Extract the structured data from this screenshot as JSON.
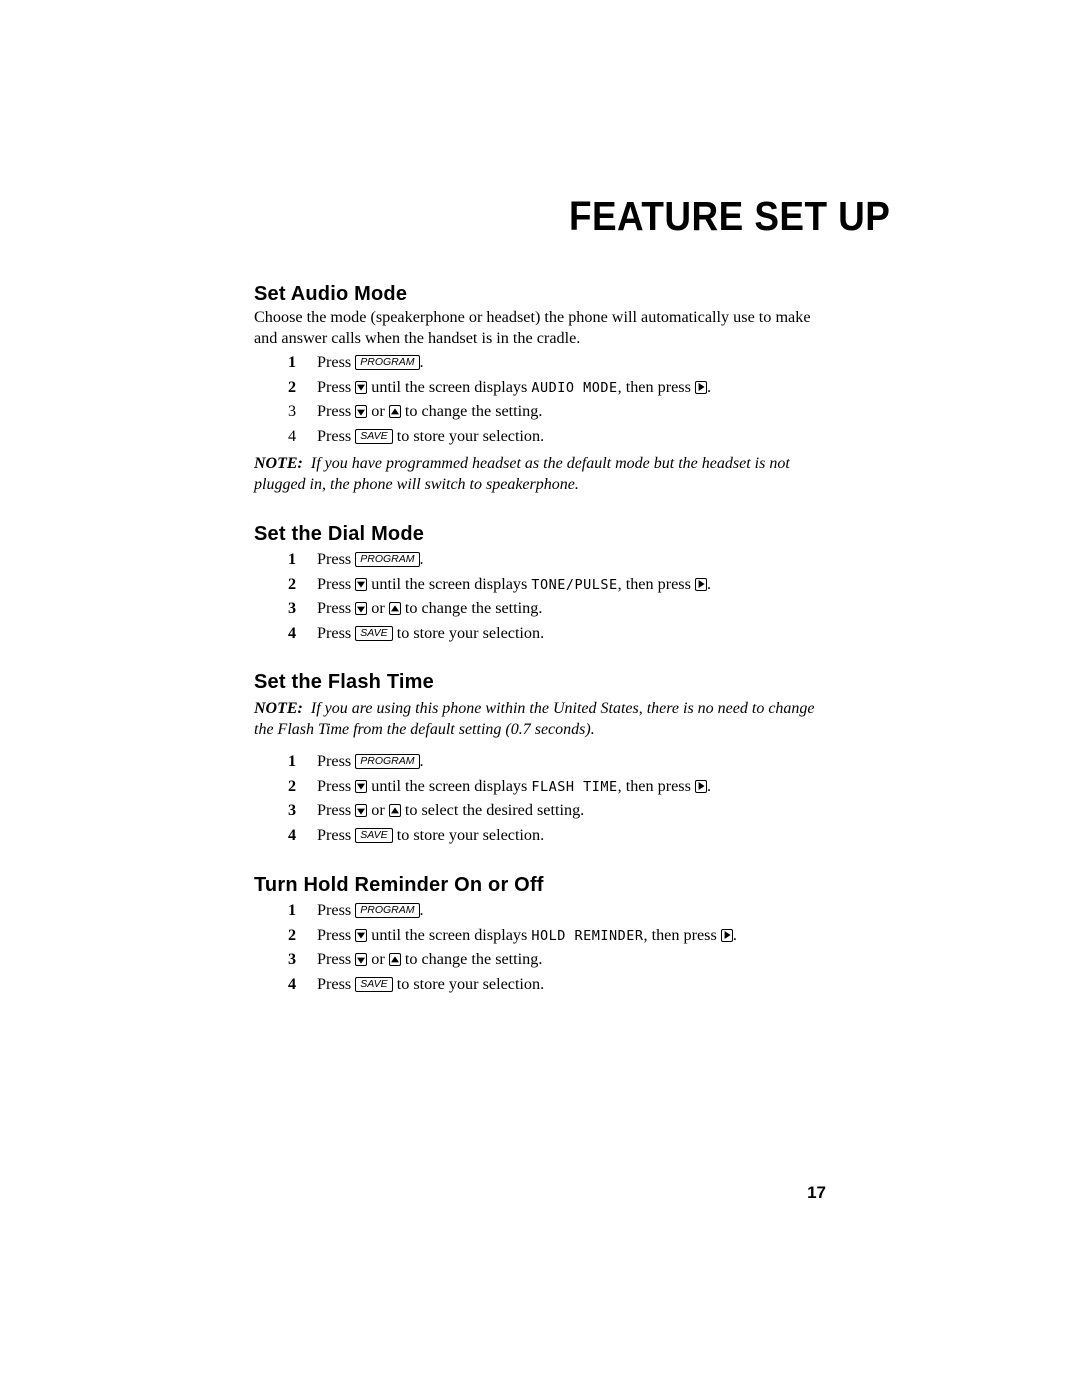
{
  "page": {
    "title": "FEATURE SET UP",
    "page_number": "17"
  },
  "keys": {
    "program": "PROGRAM",
    "save": "SAVE"
  },
  "sections": [
    {
      "heading": "Set Audio Mode",
      "intro": "Choose the mode (speakerphone or headset) the phone will automatically use to make and answer calls when the handset is in the cradle.",
      "steps": [
        {
          "num": "1",
          "press": "Press",
          "after": "."
        },
        {
          "num": "2",
          "press": "Press",
          "mid": "until the screen displays",
          "display": "AUDIO MODE",
          "then": ", then press",
          "after": "."
        },
        {
          "num": "3",
          "press": "Press",
          "or": "or",
          "after": "to change the setting."
        },
        {
          "num": "4",
          "press": "Press",
          "after": "to store your selection."
        }
      ],
      "note_label": "NOTE:",
      "note": "If you have programmed headset as the default mode but the headset is not plugged in, the phone will switch to speakerphone."
    },
    {
      "heading": "Set the Dial Mode",
      "steps": [
        {
          "num": "1",
          "press": "Press",
          "after": "."
        },
        {
          "num": "2",
          "press": "Press",
          "mid": "until the screen displays",
          "display": "TONE/PULSE",
          "then": ", then press",
          "after": "."
        },
        {
          "num": "3",
          "press": "Press",
          "or": "or",
          "after": "to change the setting."
        },
        {
          "num": "4",
          "press": "Press",
          "after": "to store your selection."
        }
      ]
    },
    {
      "heading": "Set the Flash Time",
      "note_label": "NOTE:",
      "note": "If you are using this phone within the United States, there is no need to change the Flash Time from the default setting (0.7 seconds).",
      "steps": [
        {
          "num": "1",
          "press": "Press",
          "after": "."
        },
        {
          "num": "2",
          "press": "Press",
          "mid": "until the screen displays",
          "display": "FLASH TIME",
          "then": ", then press",
          "after": "."
        },
        {
          "num": "3",
          "press": "Press",
          "or": "or",
          "after": "to select the desired setting."
        },
        {
          "num": "4",
          "press": "Press",
          "after": "to store your selection."
        }
      ]
    },
    {
      "heading": "Turn Hold Reminder On or Off",
      "steps": [
        {
          "num": "1",
          "press": "Press",
          "after": "."
        },
        {
          "num": "2",
          "press": "Press",
          "mid": "until the screen displays",
          "display": "HOLD REMINDER",
          "then": ", then press",
          "after": "."
        },
        {
          "num": "3",
          "press": "Press",
          "or": "or",
          "after": "to change the setting."
        },
        {
          "num": "4",
          "press": "Press",
          "after": "to store your selection."
        }
      ]
    }
  ]
}
